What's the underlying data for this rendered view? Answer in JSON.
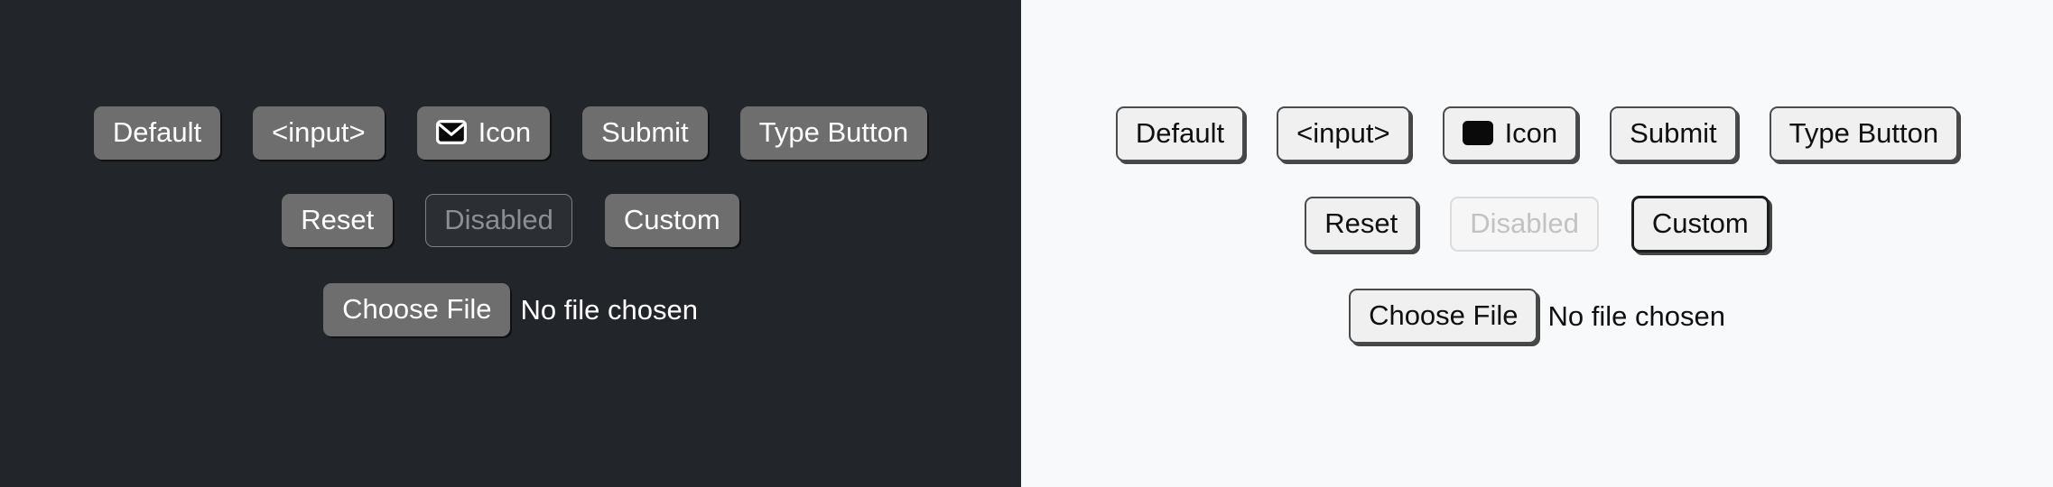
{
  "panels": [
    {
      "theme": "dark",
      "background": "#22262b",
      "button_fill": "#6e6e6e",
      "text_color": "#ffffff",
      "disabled_text_color": "#8b8f94",
      "icon_style": "envelope-outline-white",
      "rows": {
        "row1": [
          {
            "label": "Default",
            "kind": "default"
          },
          {
            "label": "<input>",
            "kind": "input"
          },
          {
            "label": "Icon",
            "kind": "icon",
            "icon": "envelope-icon"
          },
          {
            "label": "Submit",
            "kind": "submit"
          },
          {
            "label": "Type Button",
            "kind": "type-button"
          }
        ],
        "row2": [
          {
            "label": "Reset",
            "kind": "reset"
          },
          {
            "label": "Disabled",
            "kind": "disabled"
          },
          {
            "label": "Custom",
            "kind": "custom"
          }
        ],
        "row3": {
          "button_label": "Choose File",
          "status_text": "No file chosen"
        }
      }
    },
    {
      "theme": "light",
      "background": "#f8f9fb",
      "button_fill": "#f0f0f0",
      "text_color": "#101010",
      "disabled_text_color": "#c2c2c2",
      "icon_style": "envelope-solid-black",
      "rows": {
        "row1": [
          {
            "label": "Default",
            "kind": "default"
          },
          {
            "label": "<input>",
            "kind": "input"
          },
          {
            "label": "Icon",
            "kind": "icon",
            "icon": "envelope-icon"
          },
          {
            "label": "Submit",
            "kind": "submit"
          },
          {
            "label": "Type Button",
            "kind": "type-button"
          }
        ],
        "row2": [
          {
            "label": "Reset",
            "kind": "reset"
          },
          {
            "label": "Disabled",
            "kind": "disabled"
          },
          {
            "label": "Custom",
            "kind": "custom"
          }
        ],
        "row3": {
          "button_label": "Choose File",
          "status_text": "No file chosen"
        }
      }
    }
  ]
}
